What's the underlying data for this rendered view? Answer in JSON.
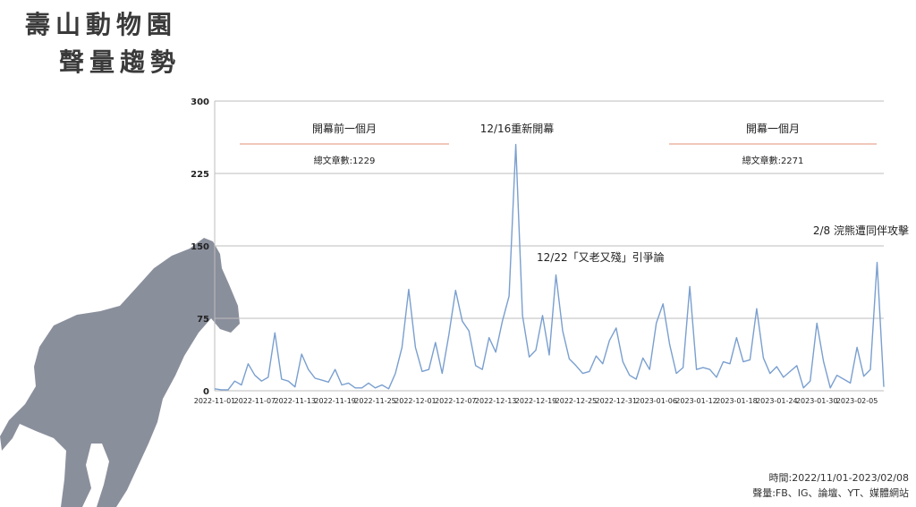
{
  "header": {
    "line1": "壽山動物園",
    "line2": "聲量趨勢"
  },
  "footer": {
    "period": "時間:2022/11/01-2023/02/08",
    "sources": "聲量:FB、IG、論壇、YT、媒體網站"
  },
  "colors": {
    "line": "#7a9fcf",
    "grid": "#bdbdbd",
    "divider": "#e8a890",
    "horse": "#8a8f9c"
  },
  "chart_data": {
    "type": "line",
    "ylim": [
      0,
      300
    ],
    "yticks": [
      0,
      75,
      150,
      225,
      300
    ],
    "x_start": "2022-11-01",
    "x_end": "2023-02-08",
    "xtick_labels": [
      "2022-11-01",
      "2022-11-07",
      "2022-11-13",
      "2022-11-19",
      "2022-11-25",
      "2022-12-01",
      "2022-12-07",
      "2022-12-13",
      "2022-12-19",
      "2022-12-25",
      "2022-12-31",
      "2023-01-06",
      "2023-01-12",
      "2023-01-18",
      "2023-01-24",
      "2023-01-30",
      "2023-02-05"
    ],
    "values": [
      2,
      1,
      1,
      10,
      6,
      28,
      16,
      10,
      14,
      60,
      12,
      10,
      4,
      38,
      22,
      13,
      11,
      9,
      22,
      6,
      8,
      3,
      3,
      8,
      3,
      6,
      2,
      18,
      45,
      105,
      45,
      20,
      22,
      50,
      18,
      58,
      104,
      72,
      62,
      26,
      22,
      55,
      40,
      72,
      98,
      255,
      78,
      35,
      42,
      78,
      37,
      120,
      62,
      33,
      26,
      18,
      20,
      36,
      28,
      52,
      65,
      30,
      16,
      12,
      34,
      22,
      70,
      90,
      48,
      18,
      24,
      108,
      22,
      24,
      22,
      14,
      30,
      28,
      55,
      30,
      32,
      85,
      34,
      18,
      25,
      14,
      20,
      26,
      3,
      10,
      70,
      30,
      3,
      16,
      12,
      8,
      45,
      15,
      22,
      133,
      4
    ],
    "annotations": [
      {
        "id": "before",
        "title": "開幕前一個月",
        "sub": "總文章數:1229"
      },
      {
        "id": "after",
        "title": "開幕一個月",
        "sub": "總文章數:2271"
      },
      {
        "id": "reopen",
        "text": "12/16重新開幕"
      },
      {
        "id": "dispute",
        "text": "12/22「又老又殘」引爭論"
      },
      {
        "id": "attack",
        "text": "2/8 浣熊遭同伴攻擊"
      }
    ]
  }
}
